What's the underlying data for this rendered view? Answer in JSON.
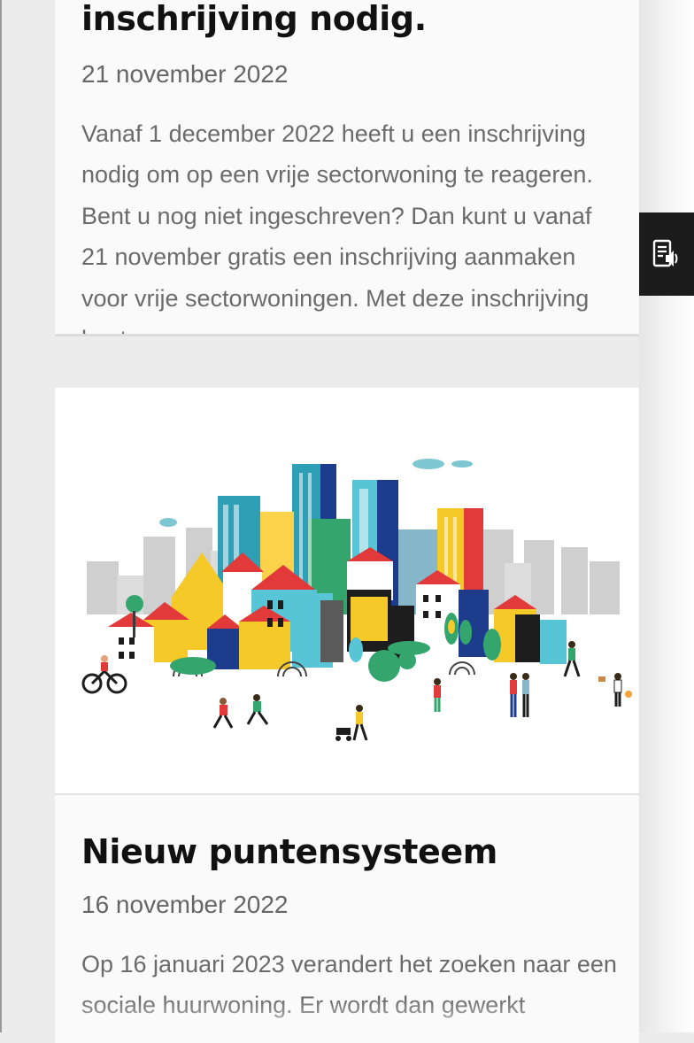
{
  "articles": [
    {
      "title": "inschrijving nodig.",
      "date": "21 november 2022",
      "excerpt": "Vanaf 1 december 2022 heeft u een inschrijving nodig om op een vrije sectorwoning te reageren. Bent u nog niet ingeschreven? Dan kunt u vanaf 21 november gratis een inschrijving aanmaken voor vrije sectorwoningen. Met deze inschrijving kunt u"
    },
    {
      "title": "Nieuw puntensysteem",
      "date": "16 november 2022",
      "excerpt": "Op 16 januari 2023 verandert het zoeken naar een sociale huurwoning. Er wordt dan gewerkt",
      "image_icon": "city-illustration"
    }
  ],
  "read_aloud": {
    "icon": "speaker-icon"
  }
}
